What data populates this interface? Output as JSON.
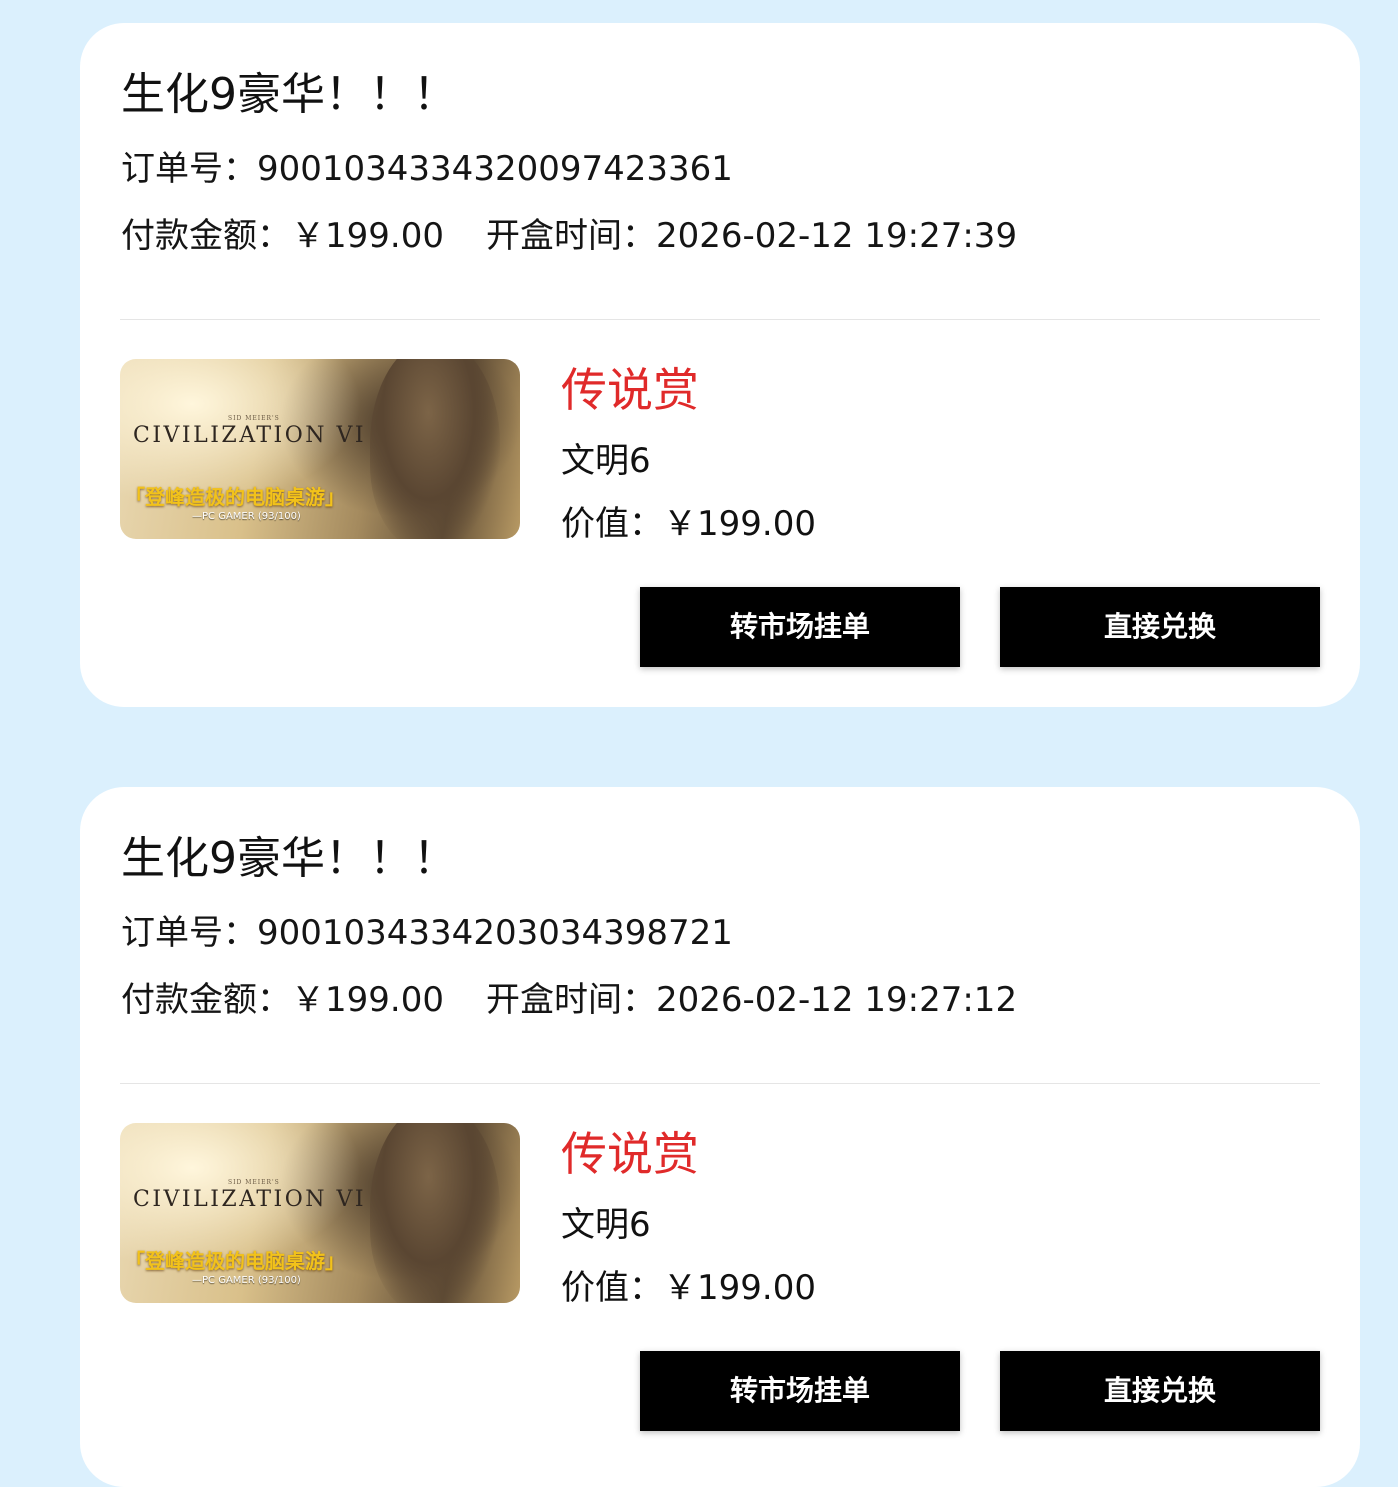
{
  "orders": [
    {
      "title": "生化9豪华！！！",
      "order_label": "订单号：",
      "order_no": "9001034334320097423361",
      "pay_label": "付款金额：",
      "pay_amount": "￥199.00",
      "open_label": "开盒时间：",
      "open_time": "2026-02-12 19:27:39",
      "prize_tier": "传说赏",
      "prize_name": "文明6",
      "value_label": "价值：",
      "value_amount": "￥199.00",
      "thumb": {
        "sid": "SID MEIER'S",
        "game_title": "CIVILIZATION VI",
        "quote": "「登峰造极的电脑桌游」",
        "source": "—PC GAMER (93/100)"
      },
      "market_button": "转市场挂单",
      "redeem_button": "直接兑换"
    },
    {
      "title": "生化9豪华！！！",
      "order_label": "订单号：",
      "order_no": "9001034334203034398721",
      "pay_label": "付款金额：",
      "pay_amount": "￥199.00",
      "open_label": "开盒时间：",
      "open_time": "2026-02-12 19:27:12",
      "prize_tier": "传说赏",
      "prize_name": "文明6",
      "value_label": "价值：",
      "value_amount": "￥199.00",
      "thumb": {
        "sid": "SID MEIER'S",
        "game_title": "CIVILIZATION VI",
        "quote": "「登峰造极的电脑桌游」",
        "source": "—PC GAMER (93/100)"
      },
      "market_button": "转市场挂单",
      "redeem_button": "直接兑换"
    }
  ],
  "colors": {
    "page_background": "#dbf0fd",
    "card_background": "#ffffff",
    "prize_tier": "#e02a2a",
    "button_background": "#000000",
    "button_text": "#ffffff"
  }
}
